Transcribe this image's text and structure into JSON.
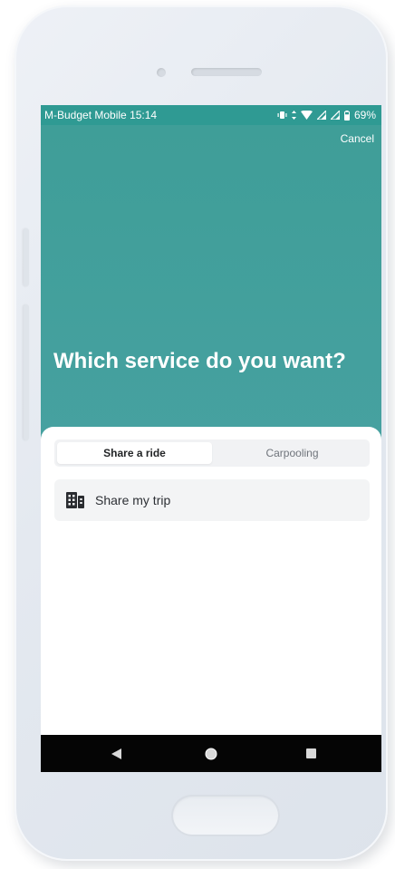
{
  "status_bar": {
    "carrier": "M-Budget Mobile",
    "time": "15:14",
    "battery": "69%",
    "icons": [
      "vibrate-icon",
      "data-arrows-icon",
      "wifi-icon",
      "signal-icon",
      "signal-icon",
      "battery-icon"
    ]
  },
  "header": {
    "cancel_label": "Cancel",
    "title": "Which service do you want?"
  },
  "tabs": [
    {
      "label": "Share a ride",
      "active": true
    },
    {
      "label": "Carpooling",
      "active": false
    }
  ],
  "options": [
    {
      "label": "Share my trip",
      "icon": "building-icon"
    }
  ],
  "nav_bar": {
    "buttons": [
      "back-icon",
      "home-icon",
      "recents-icon"
    ]
  },
  "colors": {
    "accent": "#3f9e98",
    "status_bar": "#2f9a93",
    "nav_bar": "#050505"
  }
}
